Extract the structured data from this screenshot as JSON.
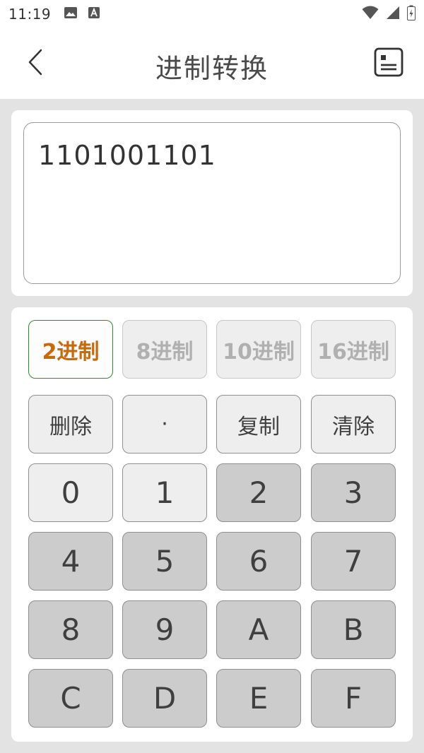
{
  "status_bar": {
    "time": "11:19",
    "left_icons": [
      "image-icon",
      "text-a-icon"
    ],
    "right_icons": [
      "wifi-icon",
      "cellular-signal-icon",
      "battery-icon"
    ]
  },
  "app_bar": {
    "title": "进制转换",
    "back_icon": "chevron-left-icon",
    "history_icon": "history-list-icon"
  },
  "display": {
    "value": "1101001101"
  },
  "bases": [
    {
      "label": "2进制",
      "active": true
    },
    {
      "label": "8进制",
      "active": false
    },
    {
      "label": "10进制",
      "active": false
    },
    {
      "label": "16进制",
      "active": false
    }
  ],
  "function_keys": {
    "delete": "删除",
    "dot": "·",
    "copy": "复制",
    "clear": "清除"
  },
  "digit_keys": [
    "0",
    "1",
    "2",
    "3",
    "4",
    "5",
    "6",
    "7",
    "8",
    "9",
    "A",
    "B",
    "C",
    "D",
    "E",
    "F"
  ],
  "colors": {
    "active_base_text": "#c8690a",
    "active_base_border": "#2e8b2e",
    "enabled_key_bg": "#eeeeee",
    "disabled_key_bg": "#cccccc"
  }
}
